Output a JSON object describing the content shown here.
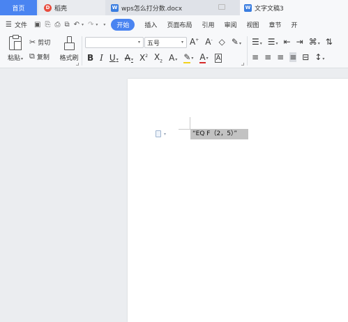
{
  "tabs": {
    "home": "首页",
    "shell": "稻壳",
    "doc1": "wps怎么打分数.docx",
    "doc2": "文字文稿3"
  },
  "menu": {
    "file": "文件",
    "items": [
      "开始",
      "插入",
      "页面布局",
      "引用",
      "审阅",
      "视图",
      "章节",
      "开"
    ]
  },
  "ribbon": {
    "paste": "粘贴",
    "cut": "剪切",
    "copy": "复制",
    "format_painter": "格式刷",
    "font_name": "",
    "font_size": "五号"
  },
  "document": {
    "field_text": "“EQ F（2，5）”"
  },
  "colors": {
    "accent": "#4a84f1",
    "selection": "#c2c2c2"
  }
}
